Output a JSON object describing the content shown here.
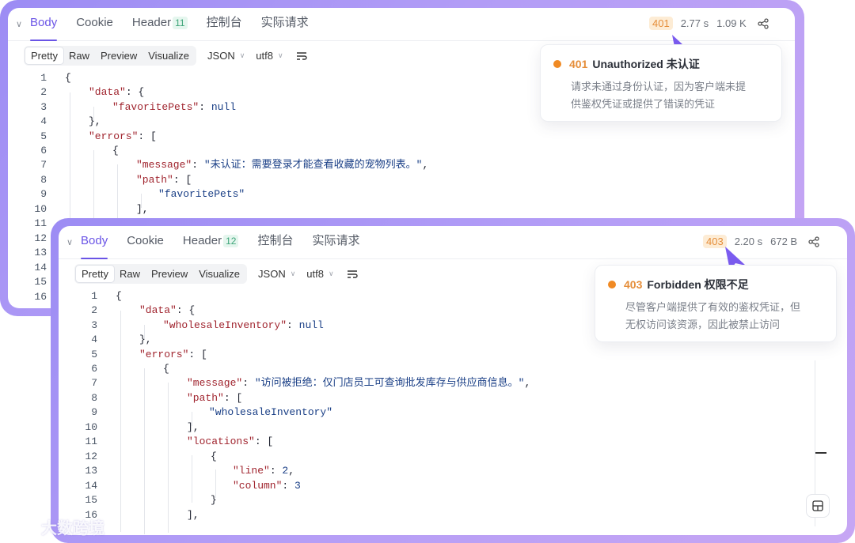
{
  "panel1": {
    "tabs": [
      "Body",
      "Cookie",
      "Header",
      "控制台",
      "实际请求"
    ],
    "header_count": "11",
    "status": "401",
    "time": "2.77 s",
    "size": "1.09 K",
    "views": [
      "Pretty",
      "Raw",
      "Preview",
      "Visualize"
    ],
    "format": "JSON",
    "encoding": "utf8",
    "tooltip": {
      "code": "401",
      "title": "Unauthorized 未认证",
      "body_line1": "请求未通过身份认证，因为客户端未提",
      "body_line2": "供鉴权凭证或提供了错误的凭证"
    },
    "line_numbers": [
      "1",
      "2",
      "3",
      "4",
      "5",
      "6",
      "7",
      "8",
      "9",
      "10",
      "11",
      "12",
      "13",
      "14",
      "15",
      "16"
    ],
    "code": {
      "l1": "{",
      "l2_key": "\"data\"",
      "l2_rest": ": {",
      "l3_key": "\"favoritePets\"",
      "l3_rest": ": ",
      "l3_val": "null",
      "l4": "},",
      "l5_key": "\"errors\"",
      "l5_rest": ": [",
      "l6": "{",
      "l7_key": "\"message\"",
      "l7_rest": ": ",
      "l7_val": "\"未认证：需要登录才能查看收藏的宠物列表。\"",
      "l7_end": ",",
      "l8_key": "\"path\"",
      "l8_rest": ": [",
      "l9_val": "\"favoritePets\"",
      "l10": "],"
    }
  },
  "panel2": {
    "tabs": [
      "Body",
      "Cookie",
      "Header",
      "控制台",
      "实际请求"
    ],
    "header_count": "12",
    "status": "403",
    "time": "2.20 s",
    "size": "672 B",
    "views": [
      "Pretty",
      "Raw",
      "Preview",
      "Visualize"
    ],
    "format": "JSON",
    "encoding": "utf8",
    "tooltip": {
      "code": "403",
      "title": "Forbidden 权限不足",
      "body_line1": "尽管客户端提供了有效的鉴权凭证，但",
      "body_line2": "无权访问该资源，因此被禁止访问"
    },
    "line_numbers": [
      "1",
      "2",
      "3",
      "4",
      "5",
      "6",
      "7",
      "8",
      "9",
      "10",
      "11",
      "12",
      "13",
      "14",
      "15",
      "16"
    ],
    "code": {
      "l1": "{",
      "l2_key": "\"data\"",
      "l2_rest": ": {",
      "l3_key": "\"wholesaleInventory\"",
      "l3_rest": ": ",
      "l3_val": "null",
      "l4": "},",
      "l5_key": "\"errors\"",
      "l5_rest": ": [",
      "l6": "{",
      "l7_key": "\"message\"",
      "l7_rest": ": ",
      "l7_val": "\"访问被拒绝：仅门店员工可查询批发库存与供应商信息。\"",
      "l7_end": ",",
      "l8_key": "\"path\"",
      "l8_rest": ": [",
      "l9_val": "\"wholesaleInventory\"",
      "l10": "],",
      "l11_key": "\"locations\"",
      "l11_rest": ": [",
      "l12": "{",
      "l13_key": "\"line\"",
      "l13_rest": ": ",
      "l13_val": "2",
      "l13_end": ",",
      "l14_key": "\"column\"",
      "l14_rest": ": ",
      "l14_val": "3",
      "l15": "}",
      "l16": "],"
    }
  },
  "watermark": "大数跨境",
  "colors": {
    "accent": "#6a54e6",
    "status": "#e58e3a",
    "frame": "#b39df6"
  }
}
